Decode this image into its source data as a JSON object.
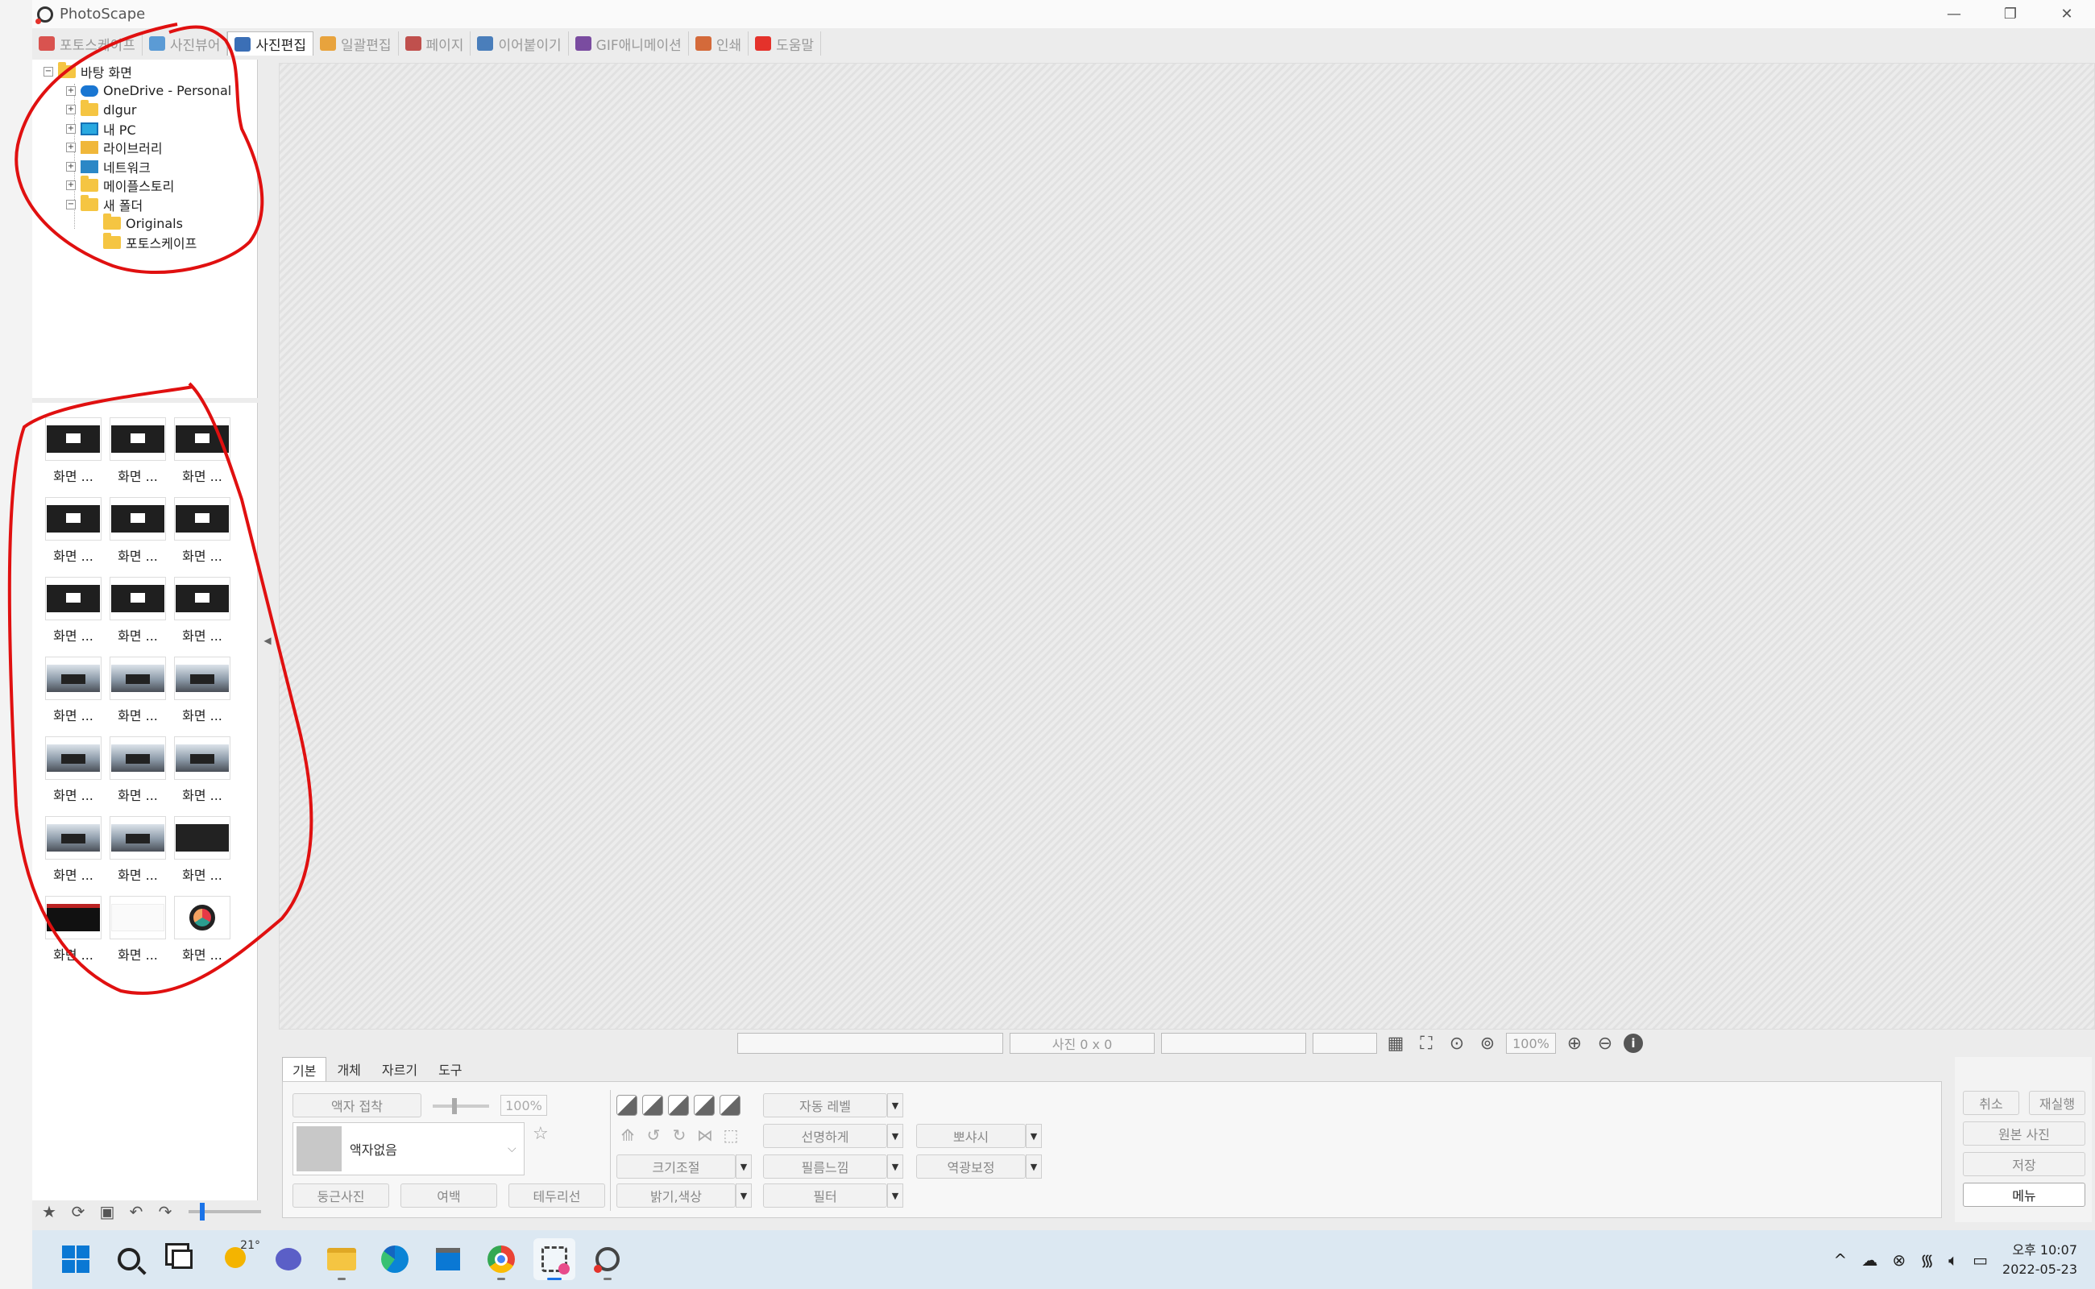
{
  "window": {
    "title": "PhotoScape",
    "controls": {
      "minimize": "—",
      "restore": "❐",
      "close": "✕"
    }
  },
  "tabs": [
    {
      "label": "포토스케이프",
      "icon": "photoscape-icon",
      "color": "#d9534f"
    },
    {
      "label": "사진뷰어",
      "icon": "viewer-icon",
      "color": "#5b9bd5"
    },
    {
      "label": "사진편집",
      "icon": "editor-icon",
      "color": "#3b6fb6",
      "active": true
    },
    {
      "label": "일괄편집",
      "icon": "batch-icon",
      "color": "#e8a33d"
    },
    {
      "label": "페이지",
      "icon": "page-icon",
      "color": "#c0504d"
    },
    {
      "label": "이어붙이기",
      "icon": "combine-icon",
      "color": "#4a7ebb"
    },
    {
      "label": "GIF애니메이션",
      "icon": "gif-icon",
      "color": "#7a4ca0"
    },
    {
      "label": "인쇄",
      "icon": "print-icon",
      "color": "#d46a3a"
    },
    {
      "label": "도움말",
      "icon": "help-icon",
      "color": "#e4322b"
    }
  ],
  "folder_tree": [
    {
      "label": "바탕 화면",
      "icon": "folder-icon",
      "level": 0,
      "expander": "−"
    },
    {
      "label": "OneDrive - Personal",
      "icon": "cloud-icon",
      "level": 1,
      "expander": "+"
    },
    {
      "label": "dlgur",
      "icon": "folder-icon",
      "level": 1,
      "expander": "+"
    },
    {
      "label": "내 PC",
      "icon": "pc-icon",
      "level": 1,
      "expander": "+"
    },
    {
      "label": "라이브러리",
      "icon": "library-icon",
      "level": 1,
      "expander": "+"
    },
    {
      "label": "네트워크",
      "icon": "network-icon",
      "level": 1,
      "expander": "+"
    },
    {
      "label": "메이플스토리",
      "icon": "folder-icon",
      "level": 1,
      "expander": "+"
    },
    {
      "label": "새 폴더",
      "icon": "folder-icon",
      "level": 1,
      "expander": "−"
    },
    {
      "label": "Originals",
      "icon": "folder-icon",
      "level": 2,
      "expander": ""
    },
    {
      "label": "포토스케이프",
      "icon": "folder-icon",
      "level": 2,
      "expander": ""
    }
  ],
  "thumbnails": {
    "label": "화면 ...",
    "kinds": [
      "dark",
      "dark",
      "dark",
      "dark",
      "dark",
      "dark",
      "dark",
      "dark",
      "dark",
      "land",
      "land",
      "land",
      "land",
      "land",
      "land",
      "land",
      "land",
      "black",
      "web",
      "doc",
      "logo"
    ]
  },
  "left_tools": [
    "★",
    "⟳",
    "▣",
    "↶",
    "↷"
  ],
  "status": {
    "photo_size": "사진 0 x 0",
    "zoom": "100%"
  },
  "edit_tabs": [
    "기본",
    "개체",
    "자르기",
    "도구"
  ],
  "basic": {
    "frame_blend": "액자 접착",
    "frame_percent": "100%",
    "frame_name": "액자없음",
    "round_photo": "둥근사진",
    "margin": "여백",
    "border_line": "테두리선",
    "resize": "크기조절",
    "bright_color": "밝기,색상",
    "auto_level": "자동 레벨",
    "sharpen": "선명하게",
    "film": "필름느낌",
    "filter": "필터",
    "bloom": "뽀샤시",
    "backlight": "역광보정"
  },
  "right_buttons": {
    "undo": "취소",
    "redo": "재실행",
    "original": "원본 사진",
    "save": "저장",
    "menu": "메뉴"
  },
  "taskbar": {
    "weather_temp": "21°",
    "time": "오후 10:07",
    "date": "2022-05-23"
  }
}
